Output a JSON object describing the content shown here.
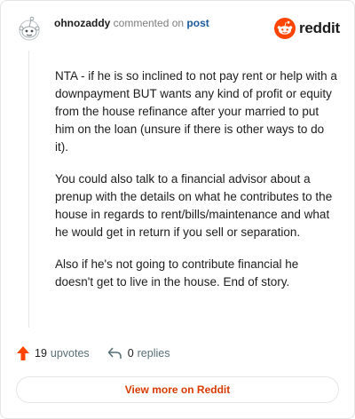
{
  "header": {
    "username": "ohnozaddy",
    "commented_text": "commented on",
    "post_link": "post",
    "brand": "reddit"
  },
  "comment": {
    "paragraphs": [
      "NTA - if he is so inclined to not pay rent or help with a downpayment BUT wants any kind of profit or equity from the house refinance after your married to put him on the loan (unsure if there is other ways to do it).",
      "You could also talk to a financial advisor about a prenup with the details on what he contributes to the house in regards to rent/bills/maintenance and what he would get in return if you sell or separation.",
      "Also if he's not going to contribute financial he doesn't get to live in the house. End of story."
    ]
  },
  "actions": {
    "upvotes_count": "19",
    "upvotes_label": "upvotes",
    "replies_count": "0",
    "replies_label": "replies"
  },
  "cta": {
    "label": "View more on Reddit"
  },
  "colors": {
    "accent": "#d93a00",
    "upvote": "#ff4500",
    "link": "#1a5a9b"
  },
  "icons": {
    "avatar": "snoo-avatar-icon",
    "brand": "reddit-logo-icon",
    "upvote": "upvote-arrow-icon",
    "reply": "reply-arrow-icon"
  }
}
